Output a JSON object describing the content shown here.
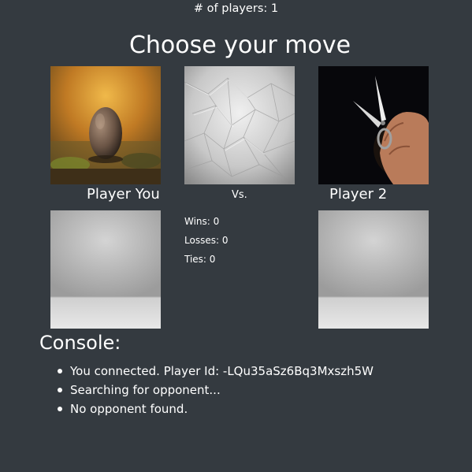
{
  "header": {
    "player_count": "# of players: 1",
    "title": "Choose your move"
  },
  "moves": [
    {
      "name": "rock",
      "icon": "rock-image"
    },
    {
      "name": "paper",
      "icon": "paper-image"
    },
    {
      "name": "scissors",
      "icon": "scissors-image"
    }
  ],
  "arena": {
    "player_you": "Player You",
    "vs": "Vs.",
    "player_two": "Player 2"
  },
  "stats": {
    "wins": "Wins: 0",
    "losses": "Losses: 0",
    "ties": "Ties: 0"
  },
  "console": {
    "title": "Console:",
    "messages": [
      "You connected. Player Id: -LQu35aSz6Bq3Mxszh5W",
      "Searching for opponent...",
      "No opponent found."
    ]
  },
  "colors": {
    "background": "#343a40",
    "text": "#ffffff"
  }
}
